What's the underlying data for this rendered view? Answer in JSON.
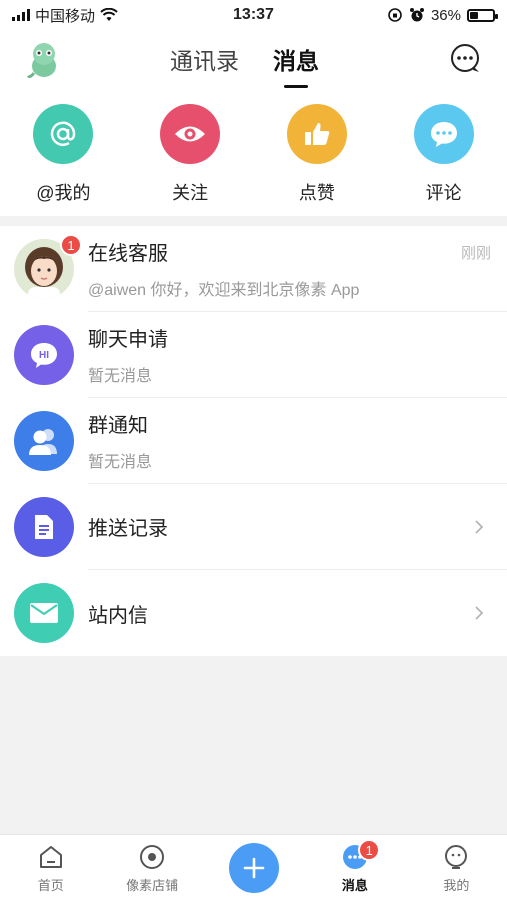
{
  "status_bar": {
    "carrier": "中国移动",
    "time": "13:37",
    "battery_percent": "36%",
    "battery_level": 0.36
  },
  "header": {
    "tabs": [
      {
        "label": "通讯录",
        "active": false
      },
      {
        "label": "消息",
        "active": true
      }
    ],
    "left_icon": "mascot-avatar-icon",
    "right_icon": "chat-bubble-icon"
  },
  "quick_actions": [
    {
      "label": "@我的",
      "icon": "at-icon",
      "color": "#42c9b0"
    },
    {
      "label": "关注",
      "icon": "eye-icon",
      "color": "#e7506c"
    },
    {
      "label": "点赞",
      "icon": "thumbs-up-icon",
      "color": "#f2b339"
    },
    {
      "label": "评论",
      "icon": "comment-icon",
      "color": "#5ac8ef"
    }
  ],
  "messages": [
    {
      "title": "在线客服",
      "subtitle": "@aiwen 你好，欢迎来到北京像素 App",
      "time": "刚刚",
      "badge": "1",
      "icon": "customer-service-avatar"
    },
    {
      "title": "聊天申请",
      "subtitle": "暂无消息",
      "icon": "hi-bubble-icon",
      "color": "#7560e8"
    },
    {
      "title": "群通知",
      "subtitle": "暂无消息",
      "icon": "group-icon",
      "color": "#3d7ee8"
    },
    {
      "title": "推送记录",
      "icon": "document-icon",
      "color": "#5a5de6"
    },
    {
      "title": "站内信",
      "icon": "mail-icon",
      "color": "#3fceb4"
    }
  ],
  "bottom_nav": [
    {
      "label": "首页",
      "icon": "home-icon"
    },
    {
      "label": "像素店铺",
      "icon": "shop-icon"
    },
    {
      "label": "",
      "icon": "plus-icon"
    },
    {
      "label": "消息",
      "icon": "message-icon",
      "active": true,
      "badge": "1"
    },
    {
      "label": "我的",
      "icon": "profile-icon"
    }
  ],
  "colors": {
    "accent_blue": "#4b9cf5",
    "badge_red": "#ec4c46"
  }
}
